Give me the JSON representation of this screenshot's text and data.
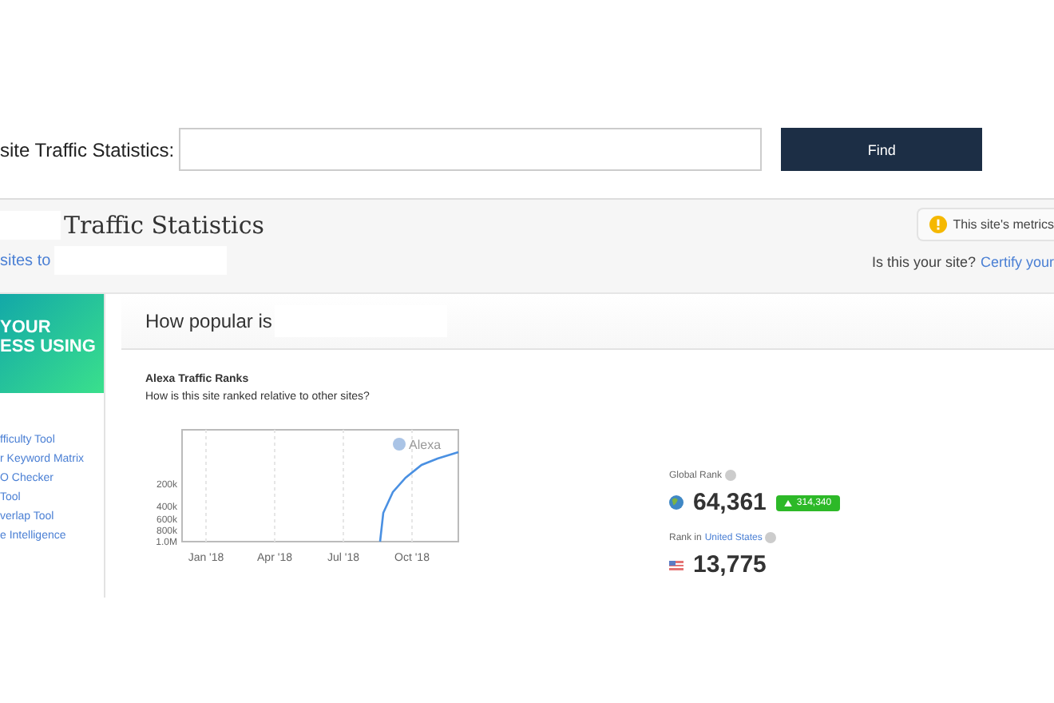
{
  "search": {
    "label": "site Traffic Statistics:",
    "button": "Find"
  },
  "header": {
    "title": "Traffic Statistics",
    "subtitle": "sites to",
    "notice": "This site's metrics",
    "claim_text": "Is this your site?",
    "claim_link": "Certify your"
  },
  "sidebar": {
    "banner_lines": [
      "YOUR",
      "ESS USING"
    ],
    "links": [
      "fficulty Tool",
      "r Keyword Matrix",
      "O Checker",
      "Tool",
      "verlap Tool",
      "e Intelligence"
    ]
  },
  "panel": {
    "heading": "How popular is",
    "section_title": "Alexa Traffic Ranks",
    "section_question": "How is this site ranked relative to other sites?",
    "chart": {
      "logo": "Alexa",
      "x_labels": [
        "Jan '18",
        "Apr '18",
        "Jul '18",
        "Oct '18"
      ],
      "y_labels": [
        "200k",
        "400k",
        "600k",
        "800k",
        "1.0M"
      ]
    },
    "global_label": "Global Rank",
    "global_value": "64,361",
    "global_change": "314,340",
    "country_label": "Rank in",
    "country_link": "United States",
    "country_value": "13,775"
  }
}
